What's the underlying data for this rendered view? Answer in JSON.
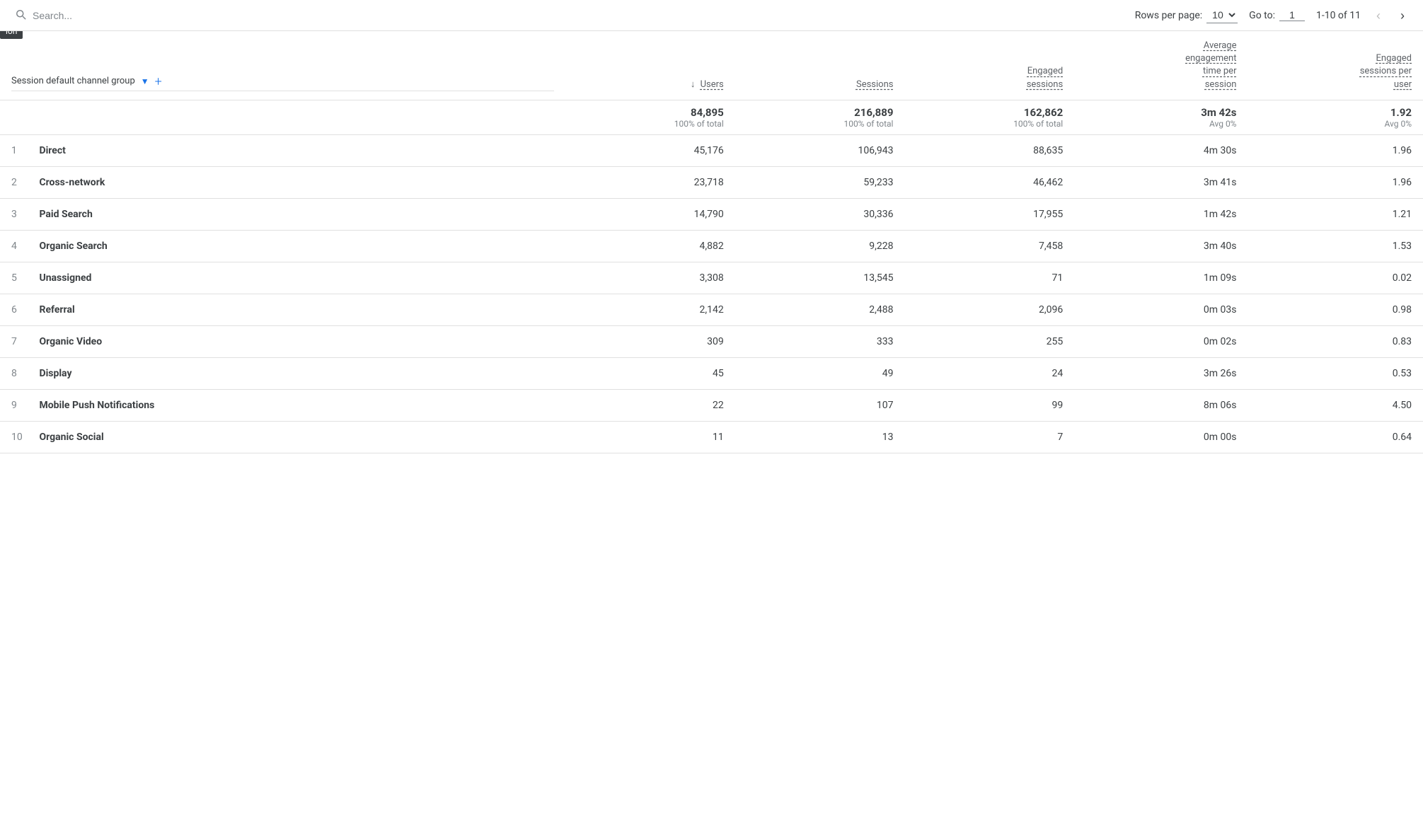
{
  "toolbar": {
    "search_placeholder": "Search...",
    "rows_per_page_label": "Rows per page:",
    "rows_per_page_value": "10",
    "goto_label": "Go to:",
    "goto_value": "1",
    "page_info": "1-10 of 11"
  },
  "dimension_header": {
    "label": "Session default channel group",
    "add_label": "+"
  },
  "columns": [
    {
      "key": "users",
      "label": "Users",
      "sortable": true,
      "sorted": true
    },
    {
      "key": "sessions",
      "label": "Sessions",
      "sortable": true
    },
    {
      "key": "engaged_sessions",
      "label": "Engaged sessions",
      "sortable": true
    },
    {
      "key": "avg_engagement",
      "label": "Average engagement time per session",
      "sortable": true
    },
    {
      "key": "engaged_per_user",
      "label": "Engaged sessions per user",
      "sortable": true
    }
  ],
  "totals": {
    "users": {
      "main": "84,895",
      "sub": "100% of total"
    },
    "sessions": {
      "main": "216,889",
      "sub": "100% of total"
    },
    "engaged_sessions": {
      "main": "162,862",
      "sub": "100% of total"
    },
    "avg_engagement": {
      "main": "3m 42s",
      "sub": "Avg 0%"
    },
    "engaged_per_user": {
      "main": "1.92",
      "sub": "Avg 0%"
    }
  },
  "rows": [
    {
      "num": 1,
      "name": "Direct",
      "users": "45,176",
      "sessions": "106,943",
      "engaged_sessions": "88,635",
      "avg_engagement": "4m 30s",
      "engaged_per_user": "1.96"
    },
    {
      "num": 2,
      "name": "Cross-network",
      "users": "23,718",
      "sessions": "59,233",
      "engaged_sessions": "46,462",
      "avg_engagement": "3m 41s",
      "engaged_per_user": "1.96"
    },
    {
      "num": 3,
      "name": "Paid Search",
      "users": "14,790",
      "sessions": "30,336",
      "engaged_sessions": "17,955",
      "avg_engagement": "1m 42s",
      "engaged_per_user": "1.21"
    },
    {
      "num": 4,
      "name": "Organic Search",
      "users": "4,882",
      "sessions": "9,228",
      "engaged_sessions": "7,458",
      "avg_engagement": "3m 40s",
      "engaged_per_user": "1.53"
    },
    {
      "num": 5,
      "name": "Unassigned",
      "users": "3,308",
      "sessions": "13,545",
      "engaged_sessions": "71",
      "avg_engagement": "1m 09s",
      "engaged_per_user": "0.02"
    },
    {
      "num": 6,
      "name": "Referral",
      "users": "2,142",
      "sessions": "2,488",
      "engaged_sessions": "2,096",
      "avg_engagement": "0m 03s",
      "engaged_per_user": "0.98"
    },
    {
      "num": 7,
      "name": "Organic Video",
      "users": "309",
      "sessions": "333",
      "engaged_sessions": "255",
      "avg_engagement": "0m 02s",
      "engaged_per_user": "0.83"
    },
    {
      "num": 8,
      "name": "Display",
      "users": "45",
      "sessions": "49",
      "engaged_sessions": "24",
      "avg_engagement": "3m 26s",
      "engaged_per_user": "0.53"
    },
    {
      "num": 9,
      "name": "Mobile Push Notifications",
      "users": "22",
      "sessions": "107",
      "engaged_sessions": "99",
      "avg_engagement": "8m 06s",
      "engaged_per_user": "4.50"
    },
    {
      "num": 10,
      "name": "Organic Social",
      "users": "11",
      "sessions": "13",
      "engaged_sessions": "7",
      "avg_engagement": "0m 00s",
      "engaged_per_user": "0.64"
    }
  ],
  "tooltip": "ion"
}
